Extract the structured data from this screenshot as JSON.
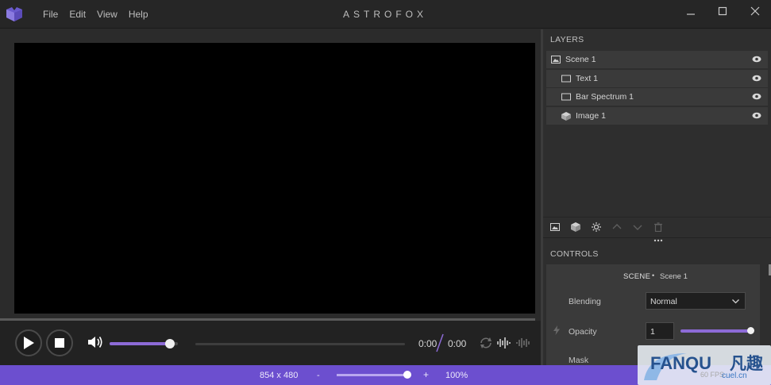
{
  "app": {
    "title": "ASTROFOX"
  },
  "menu": {
    "items": [
      "File",
      "Edit",
      "View",
      "Help"
    ]
  },
  "window_controls": {
    "minimize_icon": "minimize-icon",
    "maximize_icon": "maximize-icon",
    "close_icon": "close-icon"
  },
  "player": {
    "current_time": "0:00",
    "total_time": "0:00",
    "volume_level": 0.88,
    "icons": [
      "play-icon",
      "stop-icon",
      "volume-icon",
      "repeat-icon",
      "waveform-icon",
      "waveform-alt-icon"
    ]
  },
  "status_bar": {
    "resolution": "854 x 480",
    "zoom_out": "-",
    "zoom_in": "+",
    "zoom": "100%",
    "zoom_level": 1.0,
    "background_color": "#6c4fcf"
  },
  "layers": {
    "header": "LAYERS",
    "items": [
      {
        "name": "Scene 1",
        "icon": "image-icon"
      },
      {
        "name": "Text 1",
        "icon": "rectangle-icon"
      },
      {
        "name": "Bar Spectrum 1",
        "icon": "rectangle-icon"
      },
      {
        "name": "Image 1",
        "icon": "cube-icon"
      }
    ],
    "toolbar_icons": [
      "add-scene-icon",
      "add-element-icon",
      "add-effect-icon",
      "move-up-icon",
      "move-down-icon",
      "delete-icon"
    ]
  },
  "controls": {
    "header": "CONTROLS",
    "section_type": "SCENE",
    "section_name": "Scene 1",
    "blending_label": "Blending",
    "blending_value": "Normal",
    "opacity_label": "Opacity",
    "opacity_value": "1",
    "opacity_level": 1.0,
    "mask_label": "Mask"
  },
  "accent_color": "#8d6bd7",
  "watermark": {
    "brand": "FANQU",
    "cn": "凡趣",
    "sub": "cuel.cn",
    "fps": "60 FPS"
  }
}
